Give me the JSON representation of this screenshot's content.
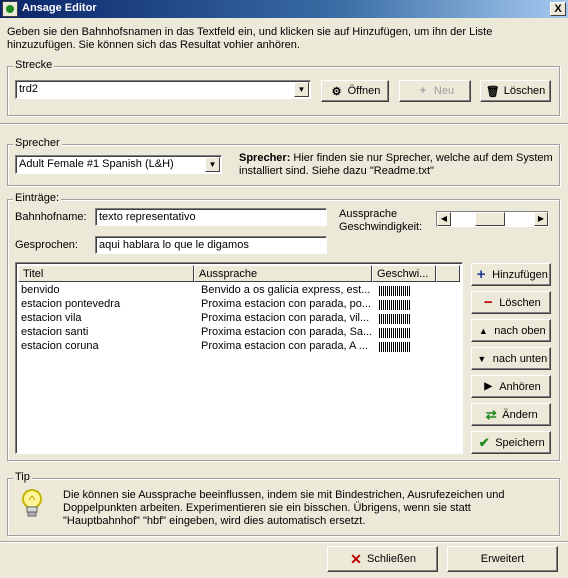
{
  "window": {
    "title": "Ansage Editor",
    "close_label": "X"
  },
  "intro_text": "Geben sie den Bahnhofsnamen in das Textfeld ein, und klicken sie auf Hinzufügen, um ihn der Liste hinzuzufügen. Sie können sich das Resultat vohier anhören.",
  "strecke": {
    "group_label": "Strecke",
    "selected": "trd2",
    "open_label": "Öffnen",
    "new_label": "Neu",
    "delete_label": "Löschen"
  },
  "sprecher": {
    "group_label": "Sprecher",
    "selected": "Adult Female #1 Spanish (L&H)",
    "info_label": "Sprecher:",
    "info_text": "Hier finden sie nur Sprecher, welche auf dem System installiert sind. Siehe dazu \"Readme.txt\""
  },
  "eintraege": {
    "group_label": "Einträge:",
    "bahnhofname_label": "Bahnhofname:",
    "bahnhofname_value": "texto representativo",
    "gesprochen_label": "Gesprochen:",
    "gesprochen_value": "aqui hablara lo que le digamos",
    "speed_label_line1": "Aussprache",
    "speed_label_line2": "Geschwindigkeit:",
    "speed_level": 0.45,
    "columns": [
      "Titel",
      "Aussprache",
      "Geschwi..."
    ],
    "rows": [
      {
        "titel": "benvido",
        "aussprache": "Benvido a os galicia express, est..."
      },
      {
        "titel": "estacion pontevedra",
        "aussprache": "Proxima estacion con parada, po..."
      },
      {
        "titel": "estacion vila",
        "aussprache": "Proxima estacion con parada, vil..."
      },
      {
        "titel": "estacion santi",
        "aussprache": "Proxima estacion con parada, Sa..."
      },
      {
        "titel": "estacion coruna",
        "aussprache": "Proxima estacion con parada, A ..."
      }
    ],
    "buttons": {
      "add": "Hinzufügen",
      "remove": "Löschen",
      "up": "nach oben",
      "down": "nach unten",
      "listen": "Anhören",
      "change": "Ändern",
      "save": "Speichern"
    }
  },
  "tip": {
    "group_label": "Tip",
    "text": "Die können sie Aussprache beeinflussen, indem sie mit Bindestrichen, Ausrufezeichen und Doppelpunkten arbeiten. Experimentieren sie ein bisschen. Übrigens, wenn sie statt \"Hauptbahnhof\" \"hbf\" eingeben, wird dies automatisch ersetzt."
  },
  "footer": {
    "close_label": "Schließen",
    "extended_label": "Erweitert"
  },
  "colors": {
    "titlebar": "#0a246a",
    "add_icon": "#1f3c9c",
    "remove_icon": "#b00000",
    "save_icon": "#1f8a1f",
    "close_icon": "#c00000"
  }
}
